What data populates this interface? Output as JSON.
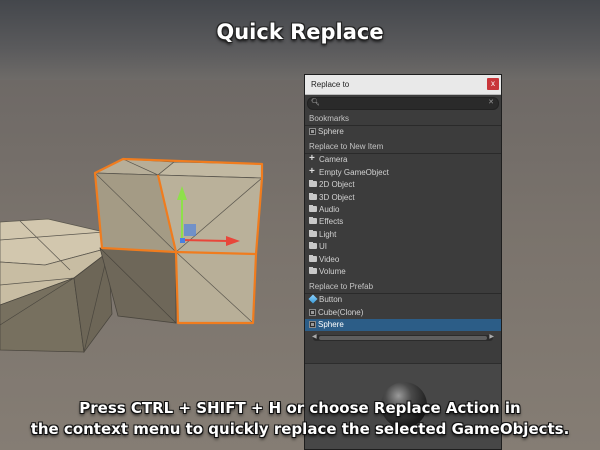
{
  "headline": "Quick Replace",
  "caption": {
    "line1": "Press CTRL + SHIFT + H or choose Replace Action in",
    "line2": "the context menu to quickly replace the selected GameObjects."
  },
  "window": {
    "title": "Replace to",
    "close_glyph": "x",
    "search": {
      "value": "",
      "placeholder": ""
    },
    "sections": {
      "bookmarks": "Bookmarks",
      "new_item": "Replace to New Item",
      "prefab": "Replace to Prefab"
    },
    "bookmarks": [
      {
        "label": "Sphere",
        "icon": "gameobject-icon"
      }
    ],
    "new_items": [
      {
        "label": "Camera",
        "icon": "plus-icon"
      },
      {
        "label": "Empty GameObject",
        "icon": "plus-icon"
      },
      {
        "label": "2D Object",
        "icon": "folder-icon"
      },
      {
        "label": "3D Object",
        "icon": "folder-icon"
      },
      {
        "label": "Audio",
        "icon": "folder-icon"
      },
      {
        "label": "Effects",
        "icon": "folder-icon"
      },
      {
        "label": "Light",
        "icon": "folder-icon"
      },
      {
        "label": "UI",
        "icon": "folder-icon"
      },
      {
        "label": "Video",
        "icon": "folder-icon"
      },
      {
        "label": "Volume",
        "icon": "folder-icon"
      }
    ],
    "prefabs": [
      {
        "label": "Button",
        "icon": "prefab-icon"
      },
      {
        "label": "Cube(Clone)",
        "icon": "gameobject-icon"
      },
      {
        "label": "Sphere",
        "icon": "gameobject-icon",
        "selected": true
      }
    ],
    "selection_color": "#2c5d87",
    "close_color": "#c8363a"
  },
  "scene": {
    "selection_outline_color": "#f07c1e",
    "gizmo_colors": {
      "x": "#e8463a",
      "y": "#8ee04a",
      "z": "#4a7fe0"
    }
  }
}
